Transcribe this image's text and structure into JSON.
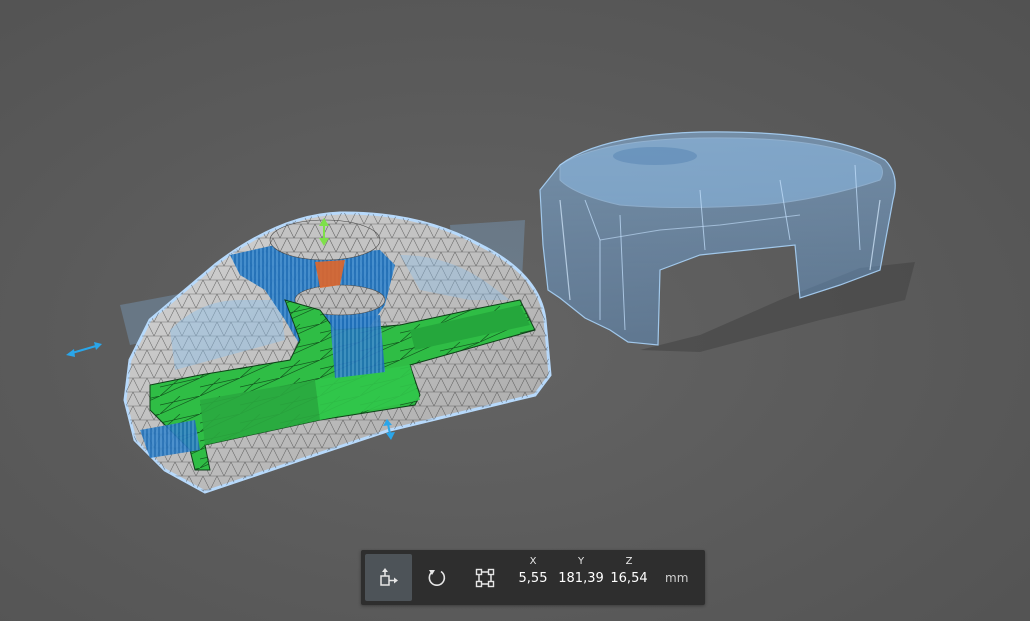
{
  "viewport": {
    "background": "#5b5b5b",
    "objects": [
      {
        "name": "sectioned-part",
        "state": "selected",
        "colors": {
          "section_fill": "#2fc24a",
          "mesh_gray": "#c9c9c9",
          "inner_blue": "#2a7fd0",
          "highlight_orange": "#e0662a"
        }
      },
      {
        "name": "transparent-cap",
        "state": "transparent",
        "colors": {
          "ghost_blue": "#7fb6ee"
        }
      }
    ],
    "gizmos": [
      "x-axis-arrow",
      "y-axis-arrow",
      "z-axis-arrow"
    ],
    "gizmo_colors": {
      "x": "#2aa6ea",
      "y": "#2aa6ea",
      "z": "#7ee04a"
    }
  },
  "toolbar": {
    "tools": [
      {
        "id": "move",
        "icon": "move-icon",
        "active": true
      },
      {
        "id": "rotate",
        "icon": "rotate-icon",
        "active": false
      },
      {
        "id": "scale",
        "icon": "scale-icon",
        "active": false
      }
    ],
    "coordinates": {
      "x": {
        "label": "X",
        "value": "5,55"
      },
      "y": {
        "label": "Y",
        "value": "181,39"
      },
      "z": {
        "label": "Z",
        "value": "16,54"
      }
    },
    "unit": "mm"
  }
}
